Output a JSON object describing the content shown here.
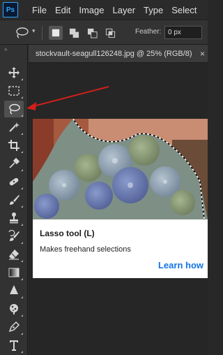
{
  "app": {
    "logo": "Ps"
  },
  "menu": {
    "items": [
      "File",
      "Edit",
      "Image",
      "Layer",
      "Type",
      "Select"
    ]
  },
  "options_bar": {
    "active_tool_icon": "lasso-icon",
    "selection_modes": [
      "new-selection-icon",
      "add-to-selection-icon",
      "subtract-from-selection-icon",
      "intersect-selection-icon"
    ],
    "feather_label": "Feather:",
    "feather_value": "0 px"
  },
  "toolbar": {
    "collapse_glyph": "»",
    "tools": [
      "move-tool-icon",
      "rectangular-marquee-icon",
      "lasso-icon",
      "magic-wand-icon",
      "crop-icon",
      "eyedropper-icon",
      "healing-brush-icon",
      "brush-icon",
      "clone-stamp-icon",
      "history-brush-icon",
      "eraser-icon",
      "gradient-icon",
      "blur-icon",
      "dodge-icon",
      "pen-icon",
      "type-icon"
    ],
    "active_tool": "lasso-icon"
  },
  "document": {
    "tab_title": "stockvault-seagull126248.jpg @ 25% (RGB/8)",
    "close_glyph": "×"
  },
  "tooltip": {
    "title": "Lasso tool (L)",
    "description": "Makes freehand selections",
    "link": "Learn how"
  },
  "colors": {
    "accent_link": "#1473e6",
    "annotation_arrow": "#d0201b",
    "ui_dark": "#323232"
  }
}
